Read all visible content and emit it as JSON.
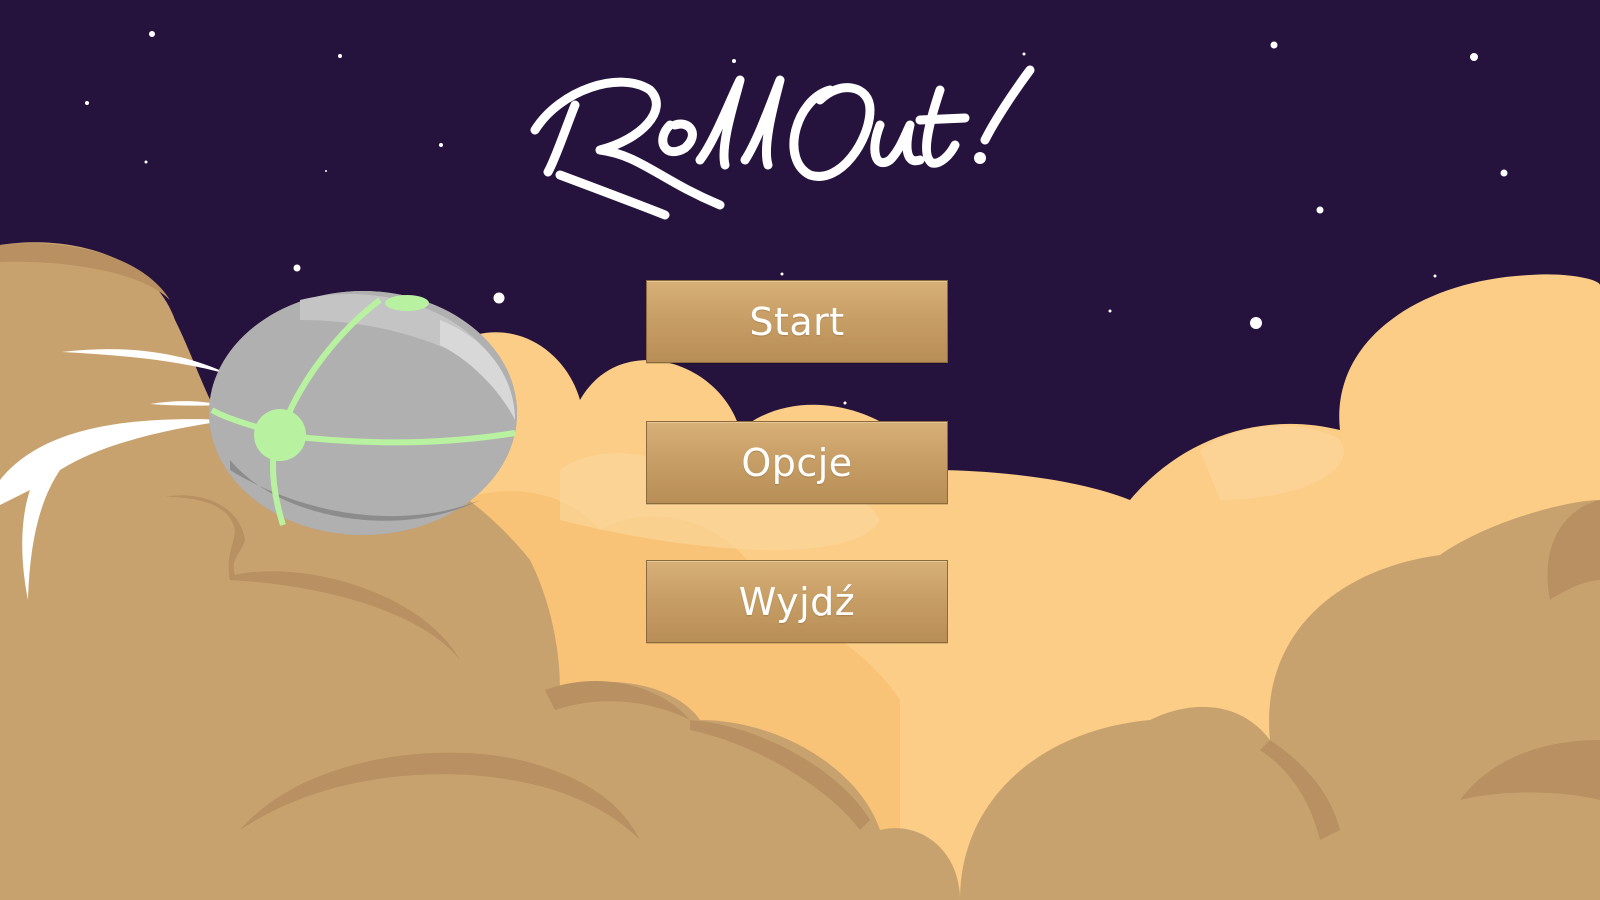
{
  "game": {
    "title": "RollOut!"
  },
  "menu": {
    "start_label": "Start",
    "options_label": "Opcje",
    "exit_label": "Wyjdź"
  },
  "colors": {
    "sky": "#25133e",
    "cloud_light": "#fbcd86",
    "cloud_dark": "#c8a26e",
    "button": "#c9a066",
    "ball_accent": "#b8f2a0"
  }
}
